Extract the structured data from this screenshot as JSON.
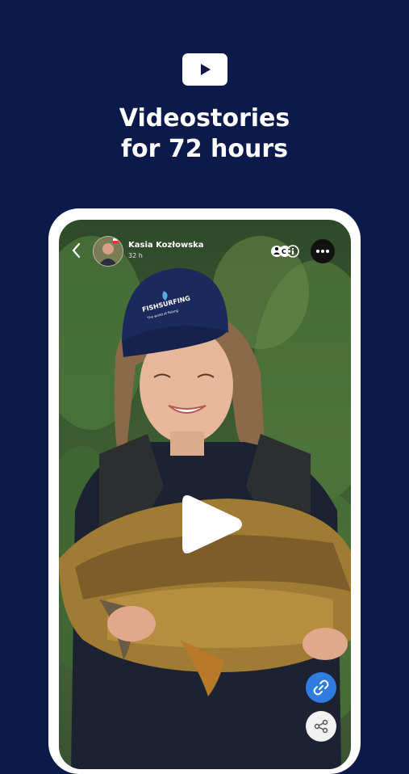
{
  "colors": {
    "background": "#0b1a4a",
    "accent": "#2f7de1"
  },
  "hero": {
    "icon": "play-icon",
    "headline_line1": "Videostories",
    "headline_line2": "for 72 hours"
  },
  "story": {
    "author": "Kasia Kozłowska",
    "time_ago": "32 h",
    "controls": {
      "back_icon": "chevron-left-icon",
      "accessibility_icon": "accessibility-info-icon",
      "more_icon": "more-dots-icon",
      "play_icon": "play-icon",
      "link_icon": "link-icon",
      "share_icon": "share-icon"
    },
    "cap_text": "FISHSURFING",
    "cap_subtext": "The world of fishing"
  }
}
